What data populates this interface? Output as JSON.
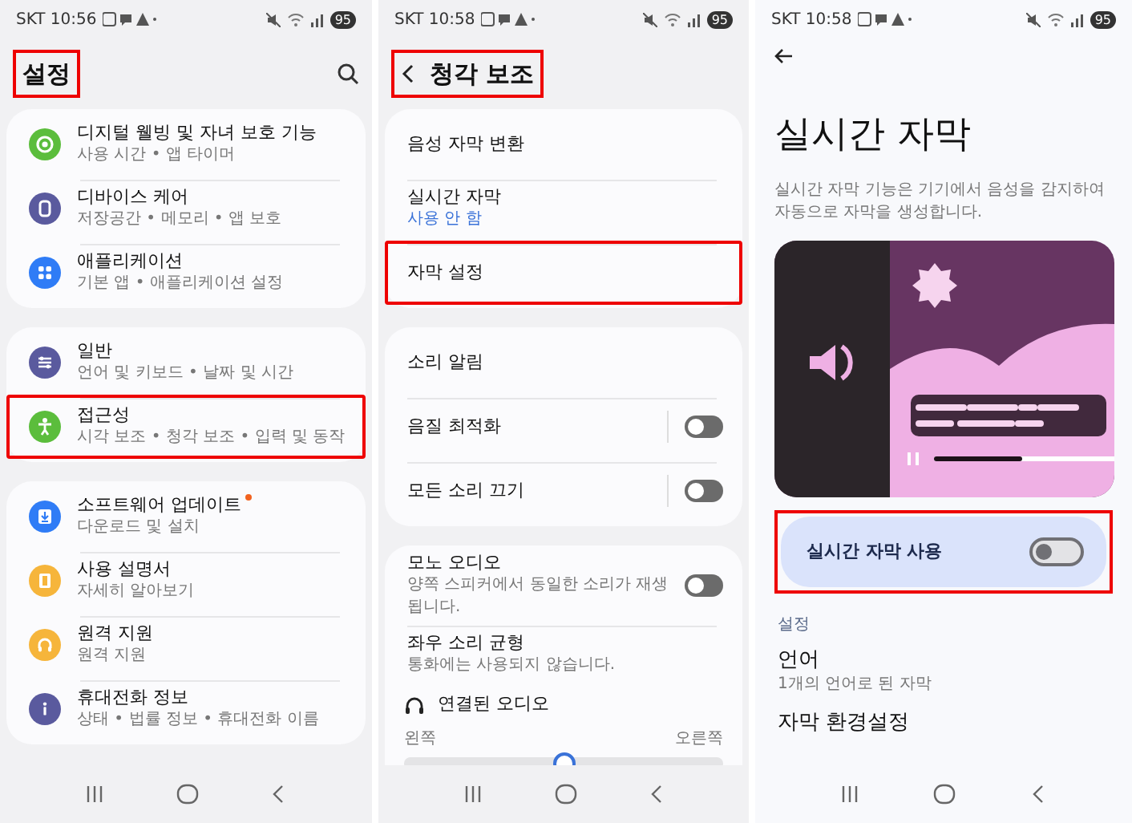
{
  "screens": [
    {
      "kind": "settings",
      "status": {
        "time": "SKT 10:56",
        "battery": "95"
      },
      "header": {
        "title": "설정",
        "back": false,
        "search": true,
        "highlighted": true
      },
      "groups": [
        [
          {
            "title": "디지털 웰빙 및 자녀 보호 기능",
            "subtitle": "사용 시간 • 앱 타이머",
            "color": "#5bbd3c",
            "highlighted": false,
            "badge": false
          },
          {
            "title": "디바이스 케어",
            "subtitle": "저장공간 • 메모리 • 앱 보호",
            "color": "#5a5a9e",
            "highlighted": false,
            "badge": false
          },
          {
            "title": "애플리케이션",
            "subtitle": "기본 앱 • 애플리케이션 설정",
            "color": "#2f7cf6",
            "highlighted": false,
            "badge": false
          }
        ],
        [
          {
            "title": "일반",
            "subtitle": "언어 및 키보드 • 날짜 및 시간",
            "color": "#5a5a9e",
            "highlighted": false,
            "badge": false
          },
          {
            "title": "접근성",
            "subtitle": "시각 보조 • 청각 보조 • 입력 및 동작",
            "color": "#5bbd3c",
            "highlighted": true,
            "badge": false
          }
        ],
        [
          {
            "title": "소프트웨어 업데이트",
            "subtitle": "다운로드 및 설치",
            "color": "#2f7cf6",
            "highlighted": false,
            "badge": true
          },
          {
            "title": "사용 설명서",
            "subtitle": "자세히 알아보기",
            "color": "#f6b53b",
            "highlighted": false,
            "badge": false
          },
          {
            "title": "원격 지원",
            "subtitle": "원격 지원",
            "color": "#f6b53b",
            "highlighted": false,
            "badge": false
          },
          {
            "title": "휴대전화 정보",
            "subtitle": "상태 • 법률 정보 • 휴대전화 이름",
            "color": "#5a5a9e",
            "highlighted": false,
            "badge": false
          }
        ]
      ]
    },
    {
      "kind": "settings",
      "status": {
        "time": "SKT 10:58",
        "battery": "95"
      },
      "header": {
        "title": "청각 보조",
        "back": true,
        "search": false,
        "highlighted": true
      },
      "groups": [
        [
          {
            "kind": "item",
            "title": "음성 자막 변환",
            "highlighted": false
          },
          {
            "kind": "item",
            "title": "실시간 자막",
            "subtitle": "사용 안 함",
            "accent": true,
            "highlighted": false
          },
          {
            "kind": "item",
            "title": "자막 설정",
            "highlighted": true
          }
        ],
        [
          {
            "kind": "item",
            "title": "소리 알림",
            "highlighted": false
          },
          {
            "kind": "toggle",
            "title": "음질 최적화",
            "on": false,
            "divider": true,
            "highlighted": false
          },
          {
            "kind": "toggle",
            "title": "모든 소리 끄기",
            "on": false,
            "divider": true,
            "highlighted": false
          }
        ],
        [
          {
            "kind": "toggle",
            "title": "모노 오디오",
            "subtitle": "양쪽 스피커에서 동일한 소리가 재생됩니다.",
            "on": false,
            "divider": false,
            "highlighted": false
          },
          {
            "kind": "item",
            "title": "좌우 소리 균형",
            "subtitle": "통화에는 사용되지 않습니다.",
            "highlighted": false
          },
          {
            "kind": "balance",
            "title": "연결된 오디오",
            "left": "왼쪽",
            "right": "오른쪽",
            "level": 0.5
          }
        ]
      ]
    },
    {
      "kind": "feature",
      "status": {
        "time": "SKT 10:58",
        "battery": "95"
      },
      "title": "실시간 자막",
      "description": "실시간 자막 기능은 기기에서 음성을 감지하여 자동으로 자막을 생성합니다.",
      "master": {
        "label": "실시간 자막 사용",
        "on": false,
        "highlighted": true
      },
      "section": "설정",
      "items": [
        {
          "title": "언어",
          "subtitle": "1개의 언어로 된 자막"
        },
        {
          "title": "자막 환경설정"
        }
      ]
    }
  ]
}
